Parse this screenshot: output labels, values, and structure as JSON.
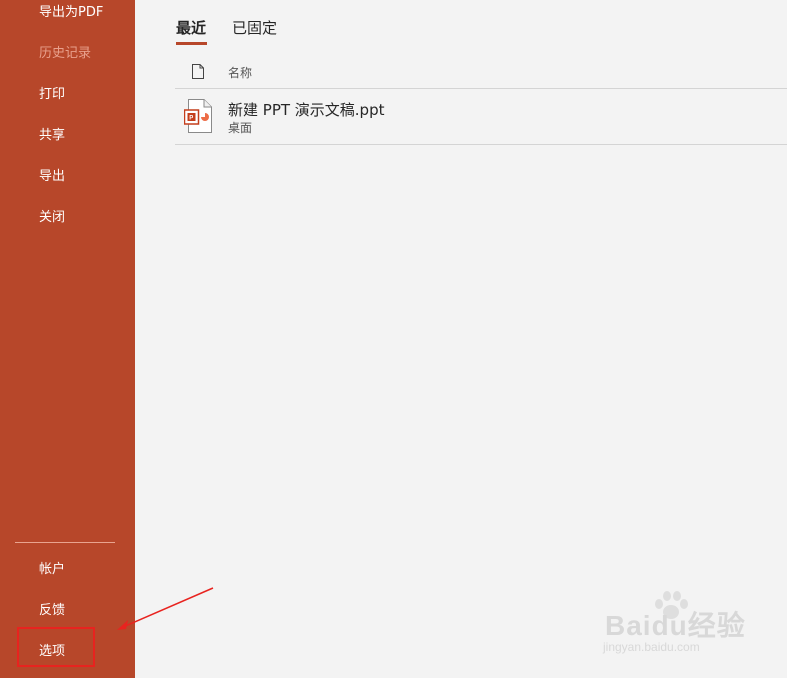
{
  "sidebar": {
    "items": [
      {
        "label": "导出为PDF"
      },
      {
        "label": "历史记录"
      },
      {
        "label": "打印"
      },
      {
        "label": "共享"
      },
      {
        "label": "导出"
      },
      {
        "label": "关闭"
      }
    ],
    "bottom_items": [
      {
        "label": "帐户"
      },
      {
        "label": "反馈"
      },
      {
        "label": "选项"
      }
    ]
  },
  "tabs": [
    {
      "label": "最近"
    },
    {
      "label": "已固定"
    }
  ],
  "file_list": {
    "column_header": "名称",
    "files": [
      {
        "name": "新建 PPT 演示文稿.ppt",
        "location": "桌面",
        "icon": "powerpoint-file-icon"
      }
    ]
  },
  "watermark": {
    "main": "Baidu经验",
    "sub": "jingyan.baidu.com"
  },
  "colors": {
    "sidebar": "#b7472a",
    "accent": "#b7472a",
    "annotation": "#e8231f"
  }
}
